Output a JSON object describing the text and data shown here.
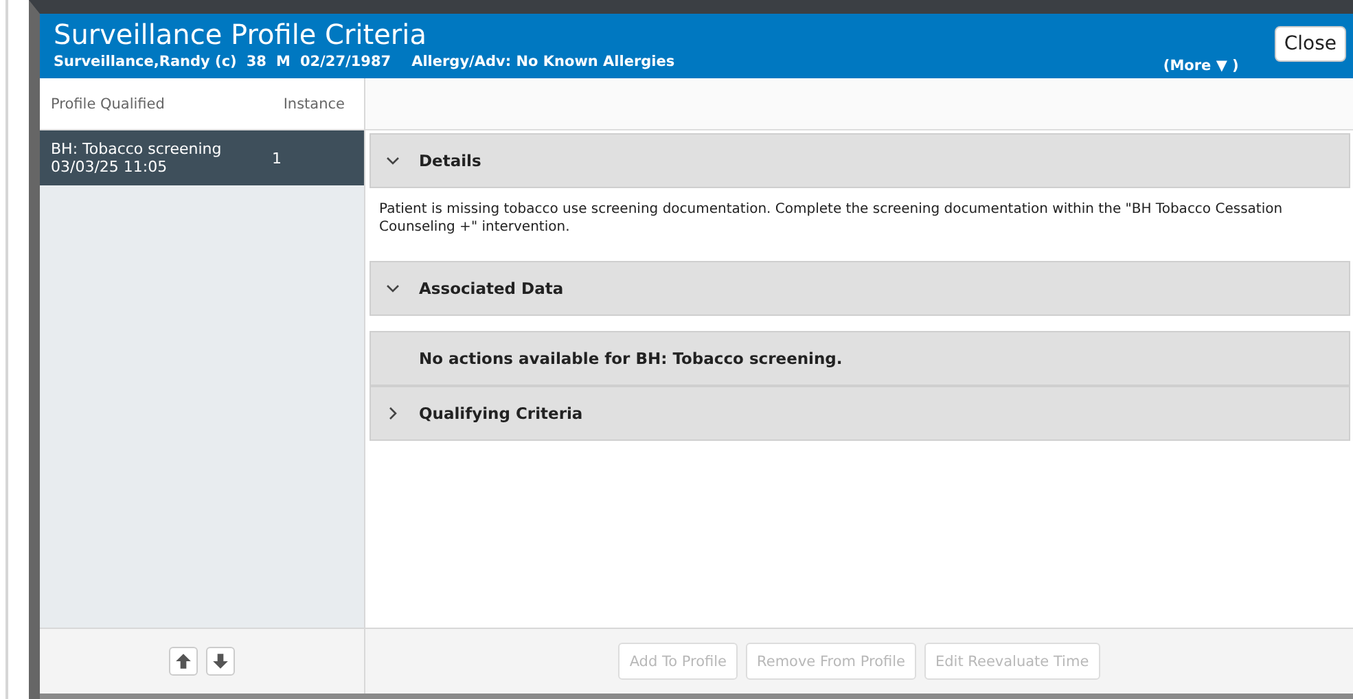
{
  "dialog": {
    "title": "Surveillance Profile Criteria",
    "patient": {
      "name": "Surveillance,Randy (c)",
      "age": "38",
      "sex": "M",
      "dob": "02/27/1987",
      "allergy": "Allergy/Adv: No Known Allergies"
    },
    "more": "(More ▼ )",
    "close": "Close"
  },
  "profile_list": {
    "columns": [
      "Profile Qualified",
      "Instance"
    ],
    "items": [
      {
        "name": "BH: Tobacco screening",
        "date": "03/03/25 11:05",
        "instance": "1",
        "selected": true
      }
    ]
  },
  "sections": [
    {
      "kind": "collapsible",
      "title": "Details",
      "expanded": true,
      "body": "Patient is missing tobacco use screening documentation. Complete the screening documentation within the \"BH Tobacco Cessation Counseling +\" intervention."
    },
    {
      "kind": "collapsible",
      "title": "Associated Data",
      "expanded": true
    },
    {
      "kind": "message",
      "title": "No actions available for BH: Tobacco screening."
    },
    {
      "kind": "collapsible",
      "title": "Qualifying Criteria",
      "expanded": false
    }
  ],
  "buttons": [
    {
      "label": "Add To Profile",
      "disabled": true
    },
    {
      "label": "Remove From Profile",
      "disabled": true
    },
    {
      "label": "Edit Reevaluate Time",
      "disabled": true
    }
  ]
}
